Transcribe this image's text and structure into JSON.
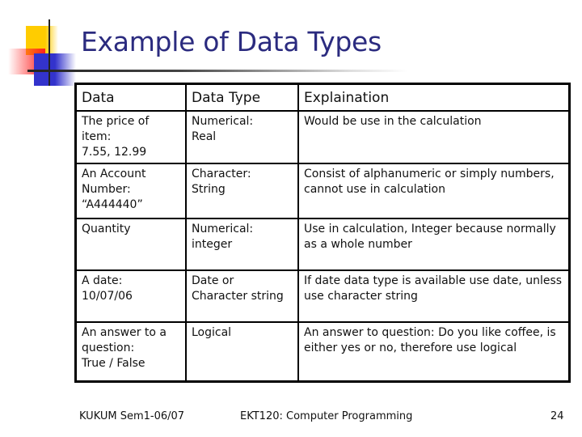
{
  "slide": {
    "title": "Example of Data Types",
    "table": {
      "headers": [
        "Data",
        "Data Type",
        "Explaination"
      ],
      "rows": [
        {
          "data": "The price of\nitem:\n7.55, 12.99",
          "type": "Numerical:\n Real",
          "explanation": "Would be use in the calculation"
        },
        {
          "data": "An Account\nNumber:\n“A444440”",
          "type": "Character:\n String",
          "explanation": "Consist of alphanumeric or simply numbers, cannot use in calculation"
        },
        {
          "data": "Quantity",
          "type": "Numerical:\n integer",
          "explanation": "Use in calculation, Integer because normally as a whole number"
        },
        {
          "data": "A date:\n10/07/06",
          "type": "Date or\nCharacter string",
          "explanation": "If date data type is available use date, unless use character string"
        },
        {
          "data": "An answer to a\nquestion:\nTrue / False",
          "type": "Logical",
          "explanation": "An answer to question: Do you like coffee, is either yes or no, therefore use logical"
        }
      ]
    },
    "footer": {
      "left": "KUKUM Sem1-06/07",
      "center": "EKT120: Computer Programming",
      "page_number": "24"
    }
  }
}
